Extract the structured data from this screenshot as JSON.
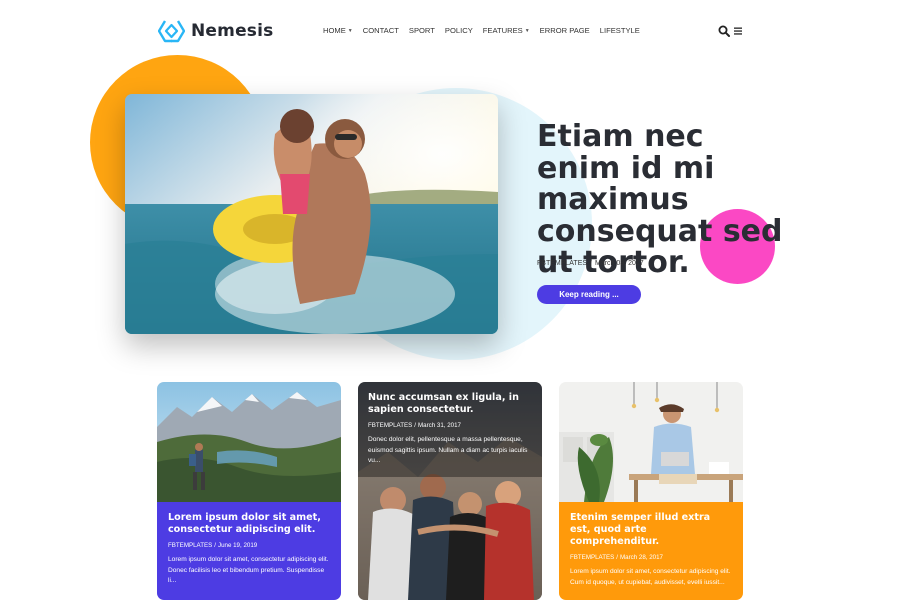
{
  "header": {
    "logo_text": "Nemesis",
    "nav": [
      {
        "label": "HOME",
        "has_dropdown": true
      },
      {
        "label": "CONTACT",
        "has_dropdown": false
      },
      {
        "label": "SPORT",
        "has_dropdown": false
      },
      {
        "label": "POLICY",
        "has_dropdown": false
      },
      {
        "label": "FEATURES",
        "has_dropdown": true
      },
      {
        "label": "ERROR PAGE",
        "has_dropdown": false
      },
      {
        "label": "LIFESTYLE",
        "has_dropdown": false
      }
    ],
    "icons": [
      "search-icon",
      "menu-icon"
    ]
  },
  "hero": {
    "title": "Etiam nec enim id mi maximus consequat sed ut tortor.",
    "author": "FBTEMPLATES",
    "separator": "/",
    "date": "March 08, 2017",
    "button_label": "Keep reading ..."
  },
  "cards": [
    {
      "title": "Lorem ipsum dolor sit amet, consectetur adipiscing elit.",
      "author": "FBTEMPLATES",
      "separator": "/",
      "date": "June 19, 2019",
      "excerpt": "Lorem ipsum dolor sit amet, consectetur adipiscing elit. Donec facilisis leo et bibendum pretium. Suspendisse li...",
      "color": "#4d3ce3"
    },
    {
      "title": "Nunc accumsan ex ligula, in sapien consectetur.",
      "author": "FBTEMPLATES",
      "separator": "/",
      "date": "March 31, 2017",
      "excerpt": "Donec dolor elit, pellentesque a massa pellentesque, euismod sagittis ipsum. Nullam a diam ac turpis iaculis vu..."
    },
    {
      "title": "Etenim semper illud extra est, quod arte comprehenditur.",
      "author": "FBTEMPLATES",
      "separator": "/",
      "date": "March 28, 2017",
      "excerpt": "Lorem ipsum dolor sit amet, consectetur adipiscing elit. Cum id quoque, ut cupiebat, audivisset, evelli iussit...",
      "color": "#ff9a0b"
    }
  ],
  "colors": {
    "accent_purple": "#4d3ce3",
    "circle_yellow": "#ffa511",
    "circle_pink": "#fb48c4",
    "circle_light_blue": "#e3f5fb",
    "card_orange": "#ff9a0b"
  }
}
